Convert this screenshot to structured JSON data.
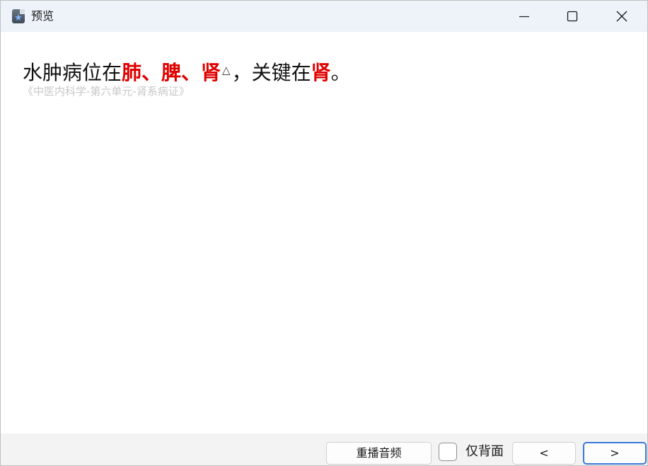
{
  "window": {
    "title": "预览",
    "controls": {
      "minimize_icon": "minimize-icon",
      "maximize_icon": "maximize-icon",
      "close_icon": "close-icon"
    }
  },
  "card": {
    "question": {
      "part1": "水肿病位在",
      "hl1": "肺、脾、肾",
      "marker": "△",
      "part2": "，关键在",
      "hl2": "肾",
      "part3": "。"
    },
    "source": "《中医内科学-第六单元-肾系病证》"
  },
  "footer": {
    "replay_label": "重播音频",
    "back_only_label": "仅背面",
    "back_only_checked": false,
    "prev_label": "<",
    "next_label": ">"
  },
  "colors": {
    "highlight": "#e00000",
    "titlebar": "#eef3fa",
    "footer": "#f3f3f3",
    "focus_border": "#3a78d6",
    "source_text": "#c8c8c8"
  }
}
